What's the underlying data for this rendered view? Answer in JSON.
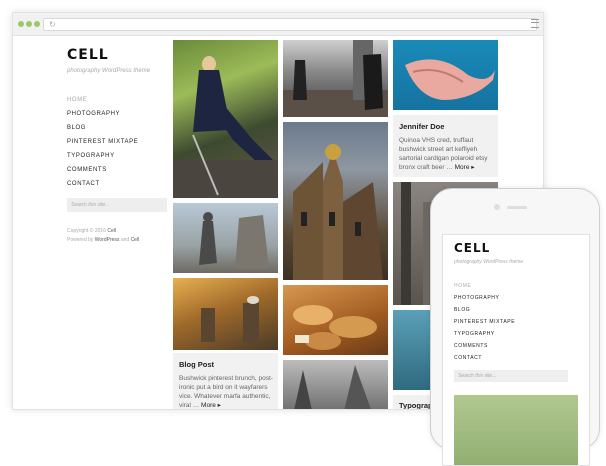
{
  "site": {
    "title": "CELL",
    "tagline": "photography WordPress theme",
    "nav": [
      "HOME",
      "PHOTOGRAPHY",
      "BLOG",
      "PINTEREST MIXTAPE",
      "TYPOGRAPHY",
      "COMMENTS",
      "CONTACT"
    ],
    "search_placeholder": "Search this site...",
    "copyright_prefix": "Copyright © 2016 ",
    "copyright_name": "Cell",
    "powered_prefix": "Powered by ",
    "powered_wp": "WordPress",
    "powered_and": " and ",
    "powered_theme": "Cell"
  },
  "cards": [
    {
      "title": "Jennifer Doe",
      "body": "Quinoa VHS cred, truffaut bushwick street art keffiyeh sartorial cardigan polaroid etsy bronx craft beer …",
      "more": "More ▸"
    },
    {
      "title": "Blog Post",
      "body": "Bushwick pinterest brunch, post-ironic put a bird on it wayfarers vice. Whatever marfa authentic, viral …",
      "more": "More ▸"
    },
    {
      "title": "Typograp"
    }
  ],
  "phone": {
    "title": "CELL",
    "tagline": "photography WordPress theme",
    "nav": [
      "HOME",
      "PHOTOGRAPHY",
      "BLOG",
      "PINTEREST MIXTAPE",
      "TYPOGRAPHY",
      "COMMENTS",
      "CONTACT"
    ],
    "search_placeholder": "Search this site..."
  },
  "colors": {
    "accent_dots": "#9ac96a",
    "card_bg": "#f1f1f1",
    "sidebar_text": "#222222"
  }
}
